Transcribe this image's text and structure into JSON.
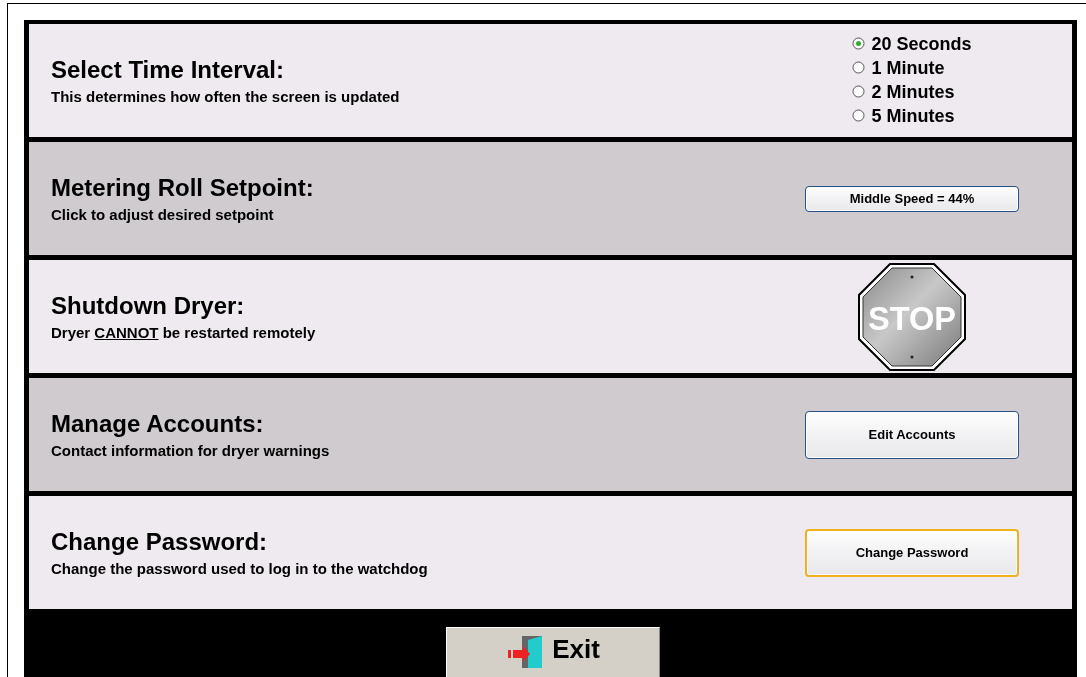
{
  "sections": [
    {
      "kind": "radio",
      "title": "Select Time Interval:",
      "subtitle": [
        {
          "text": "This determines how often the screen is updated",
          "underline": false
        }
      ],
      "options": [
        {
          "label": "20 Seconds",
          "selected": true
        },
        {
          "label": "1 Minute",
          "selected": false
        },
        {
          "label": "2 Minutes",
          "selected": false
        },
        {
          "label": "5 Minutes",
          "selected": false
        }
      ]
    },
    {
      "kind": "button",
      "title": "Metering Roll Setpoint:",
      "subtitle": [
        {
          "text": "Click to adjust desired setpoint",
          "underline": false
        }
      ],
      "button": {
        "label": "Middle Speed = 44%",
        "compact": true,
        "focused": false
      }
    },
    {
      "kind": "stop",
      "title": "Shutdown Dryer:",
      "subtitle": [
        {
          "text": "Dryer ",
          "underline": false
        },
        {
          "text": "CANNOT",
          "underline": true
        },
        {
          "text": " be restarted remotely",
          "underline": false
        }
      ],
      "sign": "STOP"
    },
    {
      "kind": "button",
      "title": "Manage Accounts:",
      "subtitle": [
        {
          "text": "Contact information for dryer warnings",
          "underline": false
        }
      ],
      "button": {
        "label": "Edit Accounts",
        "compact": false,
        "focused": false
      }
    },
    {
      "kind": "button",
      "title": "Change Password:",
      "subtitle": [
        {
          "text": "Change the password used to log in to the watchdog",
          "underline": false
        }
      ],
      "button": {
        "label": "Change Password",
        "compact": false,
        "focused": true
      }
    }
  ],
  "exit_button": {
    "label": "Exit"
  }
}
